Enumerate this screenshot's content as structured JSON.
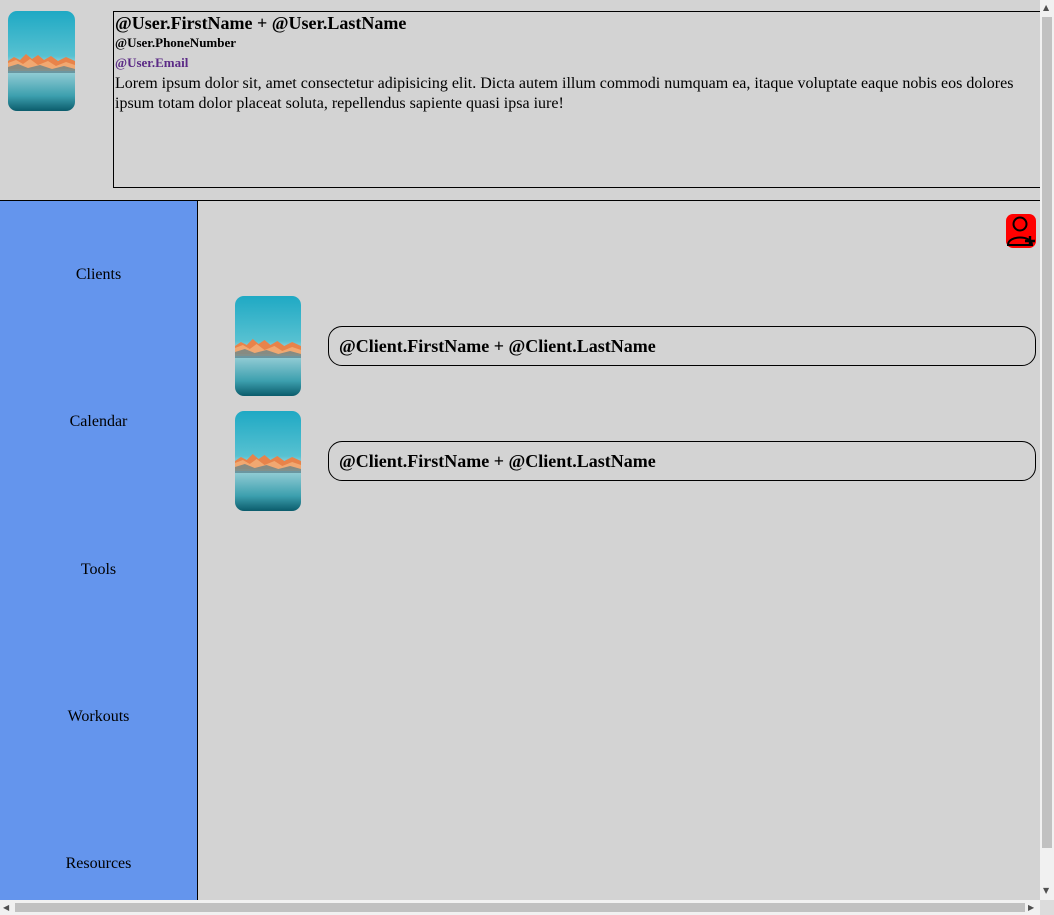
{
  "user": {
    "name": "@User.FirstName + @User.LastName",
    "phone": "@User.PhoneNumber",
    "email": "@User.Email",
    "bio": "Lorem ipsum dolor sit, amet consectetur adipisicing elit. Dicta autem illum commodi numquam ea, itaque voluptate eaque nobis eos dolores ipsum totam dolor placeat soluta, repellendus sapiente quasi ipsa iure!",
    "photo": "landscape-photo"
  },
  "sidebar": {
    "items": [
      {
        "label": "Clients"
      },
      {
        "label": "Calendar"
      },
      {
        "label": "Tools"
      },
      {
        "label": "Workouts"
      },
      {
        "label": "Resources"
      }
    ]
  },
  "main": {
    "add_client_icon": "add-user-icon",
    "clients": [
      {
        "name": "@Client.FirstName + @Client.LastName",
        "photo": "landscape-photo"
      },
      {
        "name": "@Client.FirstName + @Client.LastName",
        "photo": "landscape-photo"
      }
    ]
  },
  "colors": {
    "background": "#d3d3d3",
    "sidebar": "#6495ed",
    "add_button": "#ff0000",
    "email_link": "#5b2a86"
  }
}
